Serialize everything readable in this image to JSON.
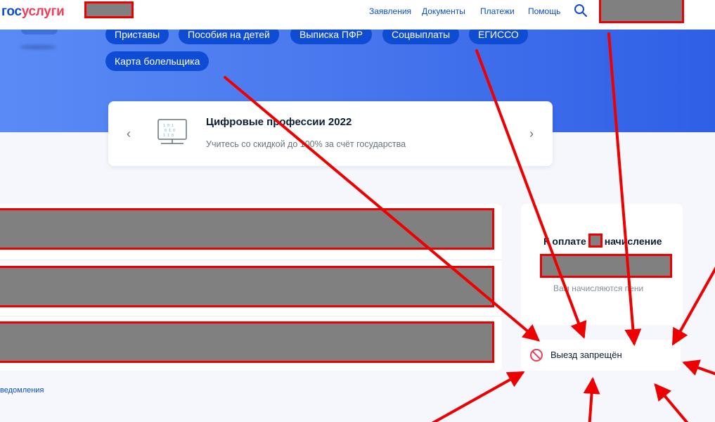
{
  "header": {
    "logo_part1": "гос",
    "logo_part2": "услуги",
    "nav": [
      "Заявления",
      "Документы",
      "Платежи",
      "Помощь"
    ]
  },
  "banner": {
    "chips_row1": [
      "Приставы",
      "Пособия на детей",
      "Выписка ПФР",
      "Соцвыплаты",
      "ЕГИССО"
    ],
    "chips_row2": [
      "Карта болельщика"
    ]
  },
  "promo": {
    "title": "Цифровые профессии 2022",
    "subtitle": "Учитесь со скидкой до 100% за счёт государства",
    "prev_icon": "chevron-left-icon",
    "next_icon": "chevron-right-icon",
    "image_icon": "monitor-icon"
  },
  "payment": {
    "title_part1": "К оплате",
    "title_part2": "начисление",
    "subtitle": "Вам начисляются пени"
  },
  "travel_ban": {
    "label": "Выезд запрещён",
    "icon": "prohibited-icon"
  },
  "footer_link": "ведомления",
  "colors": {
    "brand_blue": "#0d4cd3",
    "brand_red": "#ee3f58",
    "annotation_red": "#ee0000",
    "redaction_gray": "#808080"
  }
}
